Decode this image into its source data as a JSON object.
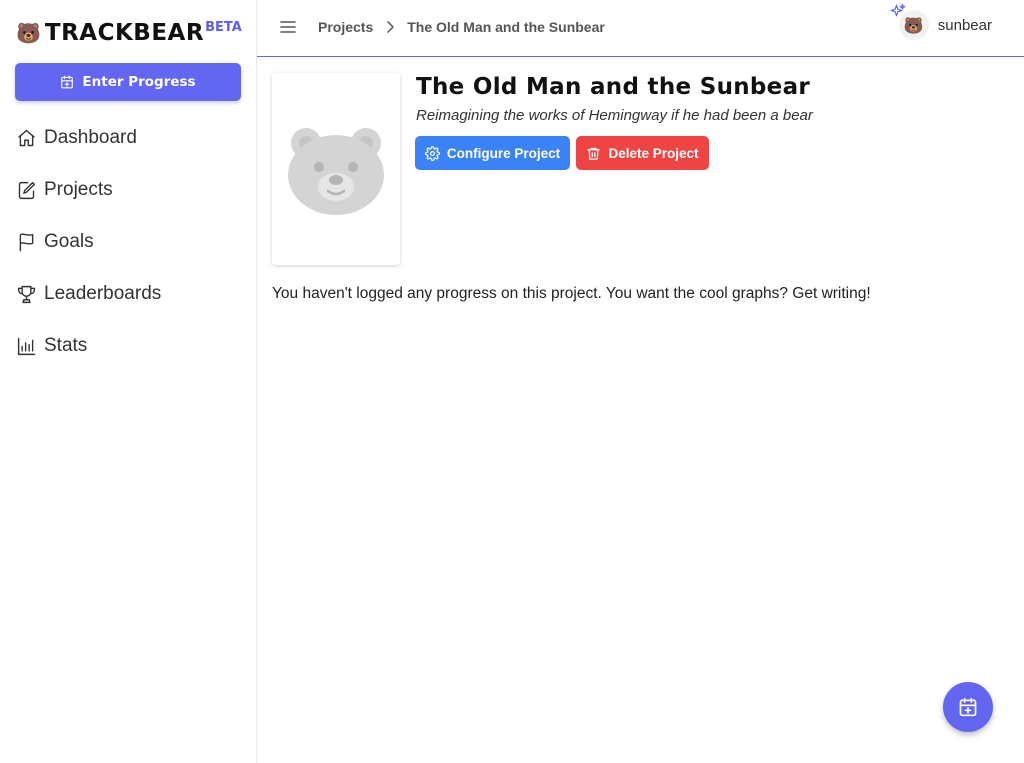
{
  "app": {
    "logo_emoji": "🐻",
    "logo_text": "TRACKBEAR",
    "beta_label": "BETA",
    "accent_color": "#6366f1"
  },
  "sidebar": {
    "enter_progress_label": "Enter Progress",
    "items": [
      {
        "label": "Dashboard",
        "icon": "home-icon"
      },
      {
        "label": "Projects",
        "icon": "edit-icon"
      },
      {
        "label": "Goals",
        "icon": "flag-icon"
      },
      {
        "label": "Leaderboards",
        "icon": "trophy-icon"
      },
      {
        "label": "Stats",
        "icon": "bar-chart-icon"
      }
    ]
  },
  "header": {
    "breadcrumb": [
      "Projects",
      "The Old Man and the Sunbear"
    ],
    "user": {
      "avatar_emoji": "🐻",
      "name": "sunbear"
    }
  },
  "project": {
    "title": "The Old Man and the Sunbear",
    "description": "Reimagining the works of Hemingway if he had been a bear",
    "configure_label": "Configure Project",
    "delete_label": "Delete Project",
    "configure_color": "#3b82f6",
    "delete_color": "#ef4444",
    "empty_message": "You haven't logged any progress on this project. You want the cool graphs? Get writing!"
  }
}
